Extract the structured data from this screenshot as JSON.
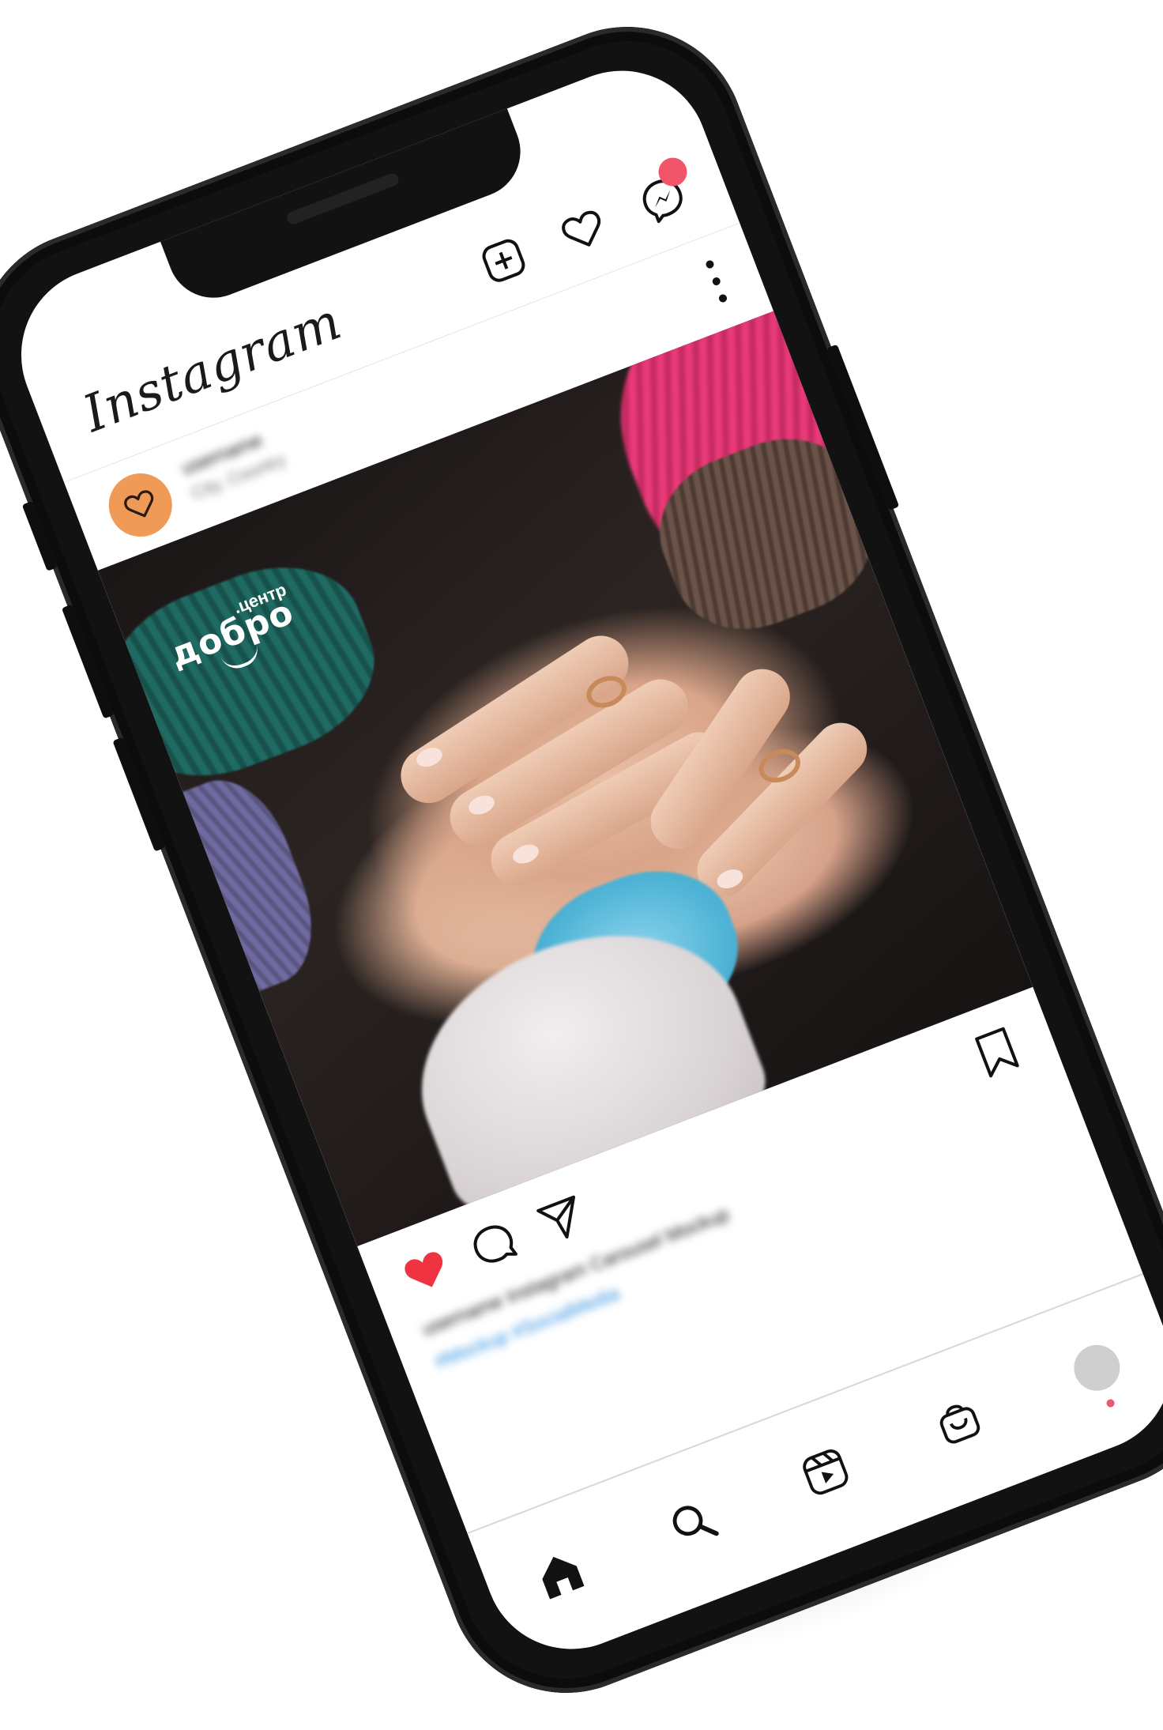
{
  "app": {
    "name": "Instagram",
    "accent": "#f0556a"
  },
  "topbar": {
    "logo_text": "Instagram",
    "icons": [
      "new-post-icon",
      "heart-icon",
      "messenger-icon"
    ],
    "messenger_badge": true
  },
  "post": {
    "username": "username",
    "location": "City, Country",
    "avatar_icon": "heart-outline-icon",
    "avatar_color": "#f09a57",
    "brand": {
      "main": "добро",
      "sub": ".центр"
    },
    "liked": true,
    "like_color": "#ef3340",
    "caption": "username Instagram Carousel Mockup",
    "hashtags": "#Mockup #SocialMedia"
  },
  "bottomnav": {
    "items": [
      "home-icon",
      "search-icon",
      "reels-icon",
      "shop-icon",
      "profile-avatar"
    ],
    "profile_notification": true
  }
}
